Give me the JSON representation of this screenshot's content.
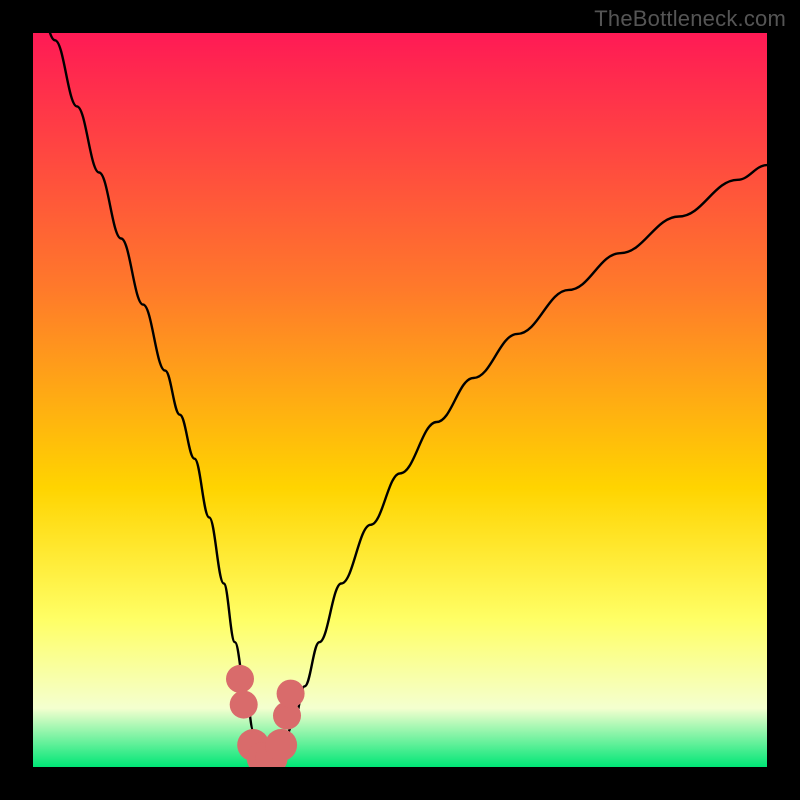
{
  "watermark": "TheBottleneck.com",
  "colors": {
    "frame": "#000000",
    "curve": "#000000",
    "marker_fill": "#d96b6b",
    "marker_stroke": "#b24f4f",
    "grad_top": "#ff1a55",
    "grad_mid1": "#ff7a2a",
    "grad_mid2": "#ffd400",
    "grad_mid3": "#ffff66",
    "grad_mid4": "#f4ffcf",
    "grad_bottom": "#00e676"
  },
  "chart_data": {
    "type": "line",
    "title": "",
    "xlabel": "",
    "ylabel": "",
    "xlim": [
      0,
      100
    ],
    "ylim": [
      0,
      100
    ],
    "series": [
      {
        "name": "bottleneck-curve",
        "x": [
          0,
          3,
          6,
          9,
          12,
          15,
          18,
          20,
          22,
          24,
          26,
          27.5,
          29,
          30,
          31,
          32,
          33,
          34,
          35.5,
          37,
          39,
          42,
          46,
          50,
          55,
          60,
          66,
          73,
          80,
          88,
          96,
          100
        ],
        "y": [
          108,
          99,
          90,
          81,
          72,
          63,
          54,
          48,
          42,
          34,
          25,
          17,
          10,
          5,
          2,
          1,
          1.5,
          3,
          6,
          11,
          17,
          25,
          33,
          40,
          47,
          53,
          59,
          65,
          70,
          75,
          80,
          82
        ]
      }
    ],
    "markers": {
      "name": "highlight-range",
      "x": [
        28.2,
        28.7,
        30.0,
        31.3,
        32.5,
        33.8,
        34.6,
        35.1
      ],
      "y": [
        12.0,
        8.5,
        3.0,
        1.2,
        1.2,
        3.0,
        7.0,
        10.0
      ],
      "size": [
        14,
        14,
        16,
        16,
        16,
        16,
        14,
        14
      ]
    }
  }
}
